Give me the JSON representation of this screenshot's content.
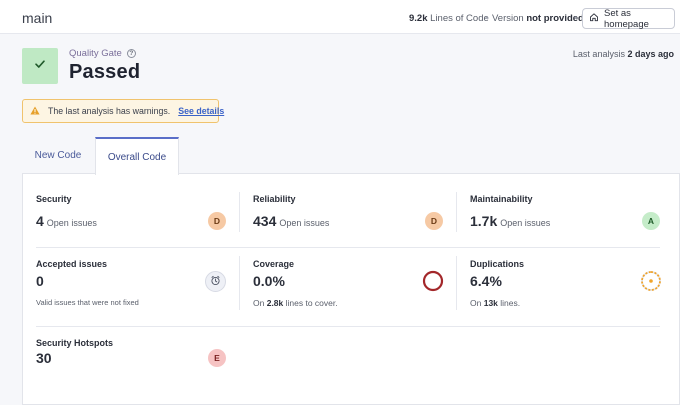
{
  "header": {
    "branch": "main",
    "lines_of_code_value": "9.2k",
    "lines_of_code_label": "Lines of Code",
    "version_label": "Version",
    "version_value": "not provided",
    "set_homepage_label": "Set as homepage"
  },
  "quality_gate": {
    "label": "Quality Gate",
    "status": "Passed",
    "last_analysis_label": "Last analysis",
    "last_analysis_value": "2 days ago"
  },
  "warning": {
    "text": "The last analysis has warnings.",
    "link": "See details"
  },
  "tabs": [
    {
      "label": "New Code",
      "active": false
    },
    {
      "label": "Overall Code",
      "active": true
    }
  ],
  "metrics": {
    "security": {
      "title": "Security",
      "value": "4",
      "unit": "Open issues",
      "rating": "D"
    },
    "reliability": {
      "title": "Reliability",
      "value": "434",
      "unit": "Open issues",
      "rating": "D"
    },
    "maintainability": {
      "title": "Maintainability",
      "value": "1.7k",
      "unit": "Open issues",
      "rating": "A"
    },
    "accepted": {
      "title": "Accepted issues",
      "value": "0",
      "note": "Valid issues that were not fixed"
    },
    "coverage": {
      "title": "Coverage",
      "value": "0.0%",
      "sub_prefix": "On",
      "sub_value": "2.8k",
      "sub_suffix": "lines to cover.",
      "percent": 0
    },
    "duplications": {
      "title": "Duplications",
      "value": "6.4%",
      "sub_prefix": "On",
      "sub_value": "13k",
      "sub_suffix": "lines.",
      "percent": 6.4
    },
    "hotspots": {
      "title": "Security Hotspots",
      "value": "30",
      "rating": "E"
    }
  },
  "colors": {
    "passed_bg": "#bfe9c4",
    "rating_d": "#f6c9a4",
    "rating_a": "#c5ecc9",
    "rating_e": "#f6c3c3",
    "coverage_ring": "#a3272a",
    "duplication_ring": "#f0a42c",
    "accent_tab": "#5a6ec8"
  }
}
